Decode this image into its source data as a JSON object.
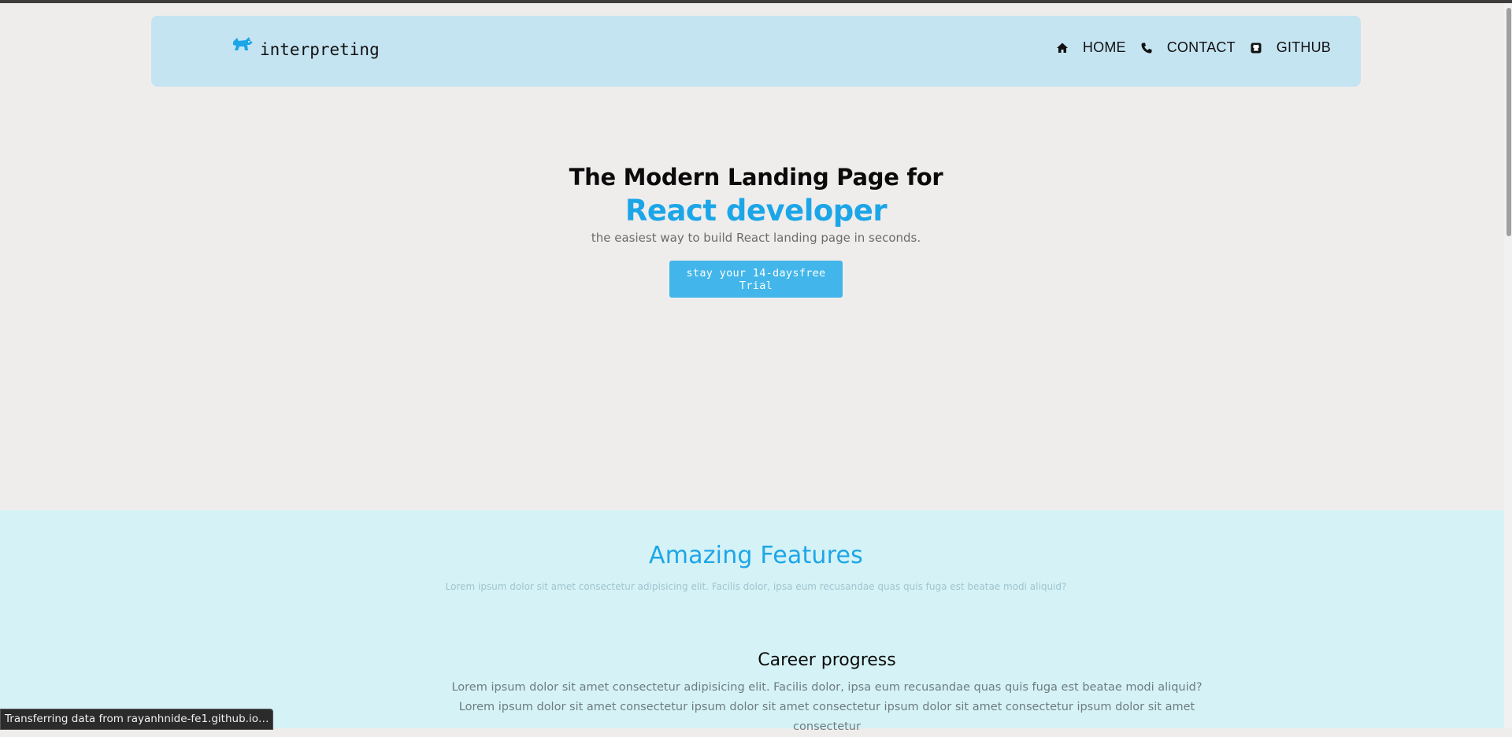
{
  "brand": {
    "name": "interpreting",
    "logo_icon": "dog-logo-icon",
    "accent": "#1ca6e8"
  },
  "nav": [
    {
      "label": "HOME",
      "icon": "home-icon"
    },
    {
      "label": "CONTACT",
      "icon": "phone-icon"
    },
    {
      "label": "GITHUB",
      "icon": "github-icon"
    }
  ],
  "hero": {
    "title": "The Modern Landing Page for",
    "accent_title": "React developer",
    "subtitle": "the easiest way to build React landing page in seconds.",
    "cta_label": "stay your 14-daysfree Trial"
  },
  "features": {
    "title": "Amazing Features",
    "subtitle": "Lorem ipsum dolor sit amet consectetur adipisicing elit. Facilis dolor, ipsa eum recusandae quas quis fuga est beatae modi aliquid?",
    "items": [
      {
        "title": "Career progress",
        "text": "Lorem ipsum dolor sit amet consectetur adipisicing elit. Facilis dolor, ipsa eum recusandae quas quis fuga est beatae modi aliquid? Lorem ipsum dolor sit amet consectetur ipsum dolor sit amet consectetur ipsum dolor sit amet consectetur ipsum dolor sit amet consectetur"
      }
    ]
  },
  "status_bar": {
    "text": "Transferring data from rayanhnide-fe1.github.io…"
  },
  "colors": {
    "navbar_bg": "#c5e4f2",
    "page_bg": "#efedeb",
    "features_bg": "#d5f2f6",
    "cta_bg": "#42b6ea"
  }
}
